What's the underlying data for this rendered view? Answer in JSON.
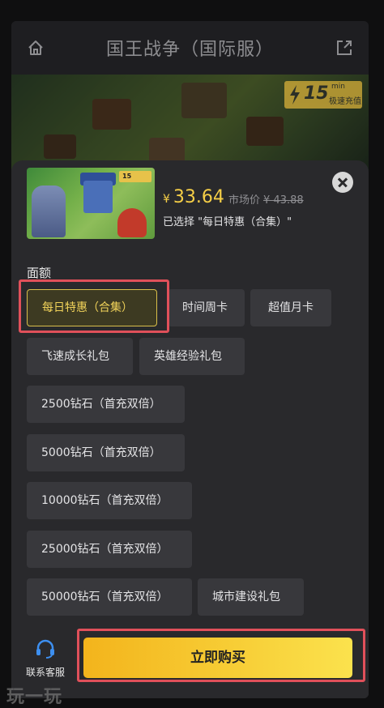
{
  "header": {
    "title": "国王战争（国际服）",
    "home_icon": "home-icon",
    "share_icon": "share-icon"
  },
  "banner": {
    "badge_number": "15",
    "badge_unit": "min",
    "badge_text": "极速充值"
  },
  "product": {
    "thumb_badge": "15",
    "currency_symbol": "¥",
    "price": "33.64",
    "market_label": "市场价",
    "market_price": "¥ 43.88",
    "selected_text": "已选择 \"每日特惠（合集）\""
  },
  "denominations": {
    "label": "面额",
    "options": [
      {
        "label": "每日特惠（合集）",
        "selected": true
      },
      {
        "label": "时间周卡",
        "selected": false
      },
      {
        "label": "超值月卡",
        "selected": false
      },
      {
        "label": "飞速成长礼包",
        "selected": false
      },
      {
        "label": "英雄经验礼包",
        "selected": false
      },
      {
        "label": "2500钻石（首充双倍）",
        "selected": false
      },
      {
        "label": "5000钻石（首充双倍）",
        "selected": false
      },
      {
        "label": "10000钻石（首充双倍）",
        "selected": false
      },
      {
        "label": "25000钻石（首充双倍）",
        "selected": false
      },
      {
        "label": "50000钻石（首充双倍）",
        "selected": false
      },
      {
        "label": "城市建设礼包",
        "selected": false
      }
    ]
  },
  "footer": {
    "service_label": "联系客服",
    "buy_label": "立即购买"
  },
  "watermark": "玩一玩",
  "colors": {
    "accent": "#f6cf47",
    "highlight": "#e0505a",
    "button_start": "#f3b41c",
    "button_end": "#fbe24d"
  }
}
